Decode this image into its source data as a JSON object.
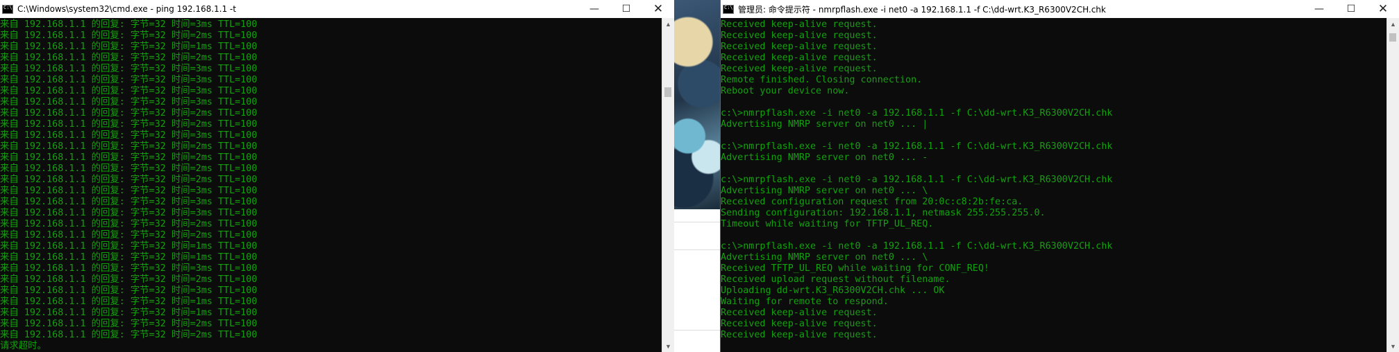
{
  "colors": {
    "console_bg": "#0c0c0c",
    "console_text": "#13a10e",
    "titlebar_bg": "#ffffff"
  },
  "left_window": {
    "title": "C:\\Windows\\system32\\cmd.exe - ping  192.168.1.1 -t",
    "icon": "cmd-icon",
    "controls": {
      "minimize": "—",
      "maximize": "☐",
      "close": "✕"
    },
    "lines": [
      "来自 192.168.1.1 的回复: 字节=32 时间=3ms TTL=100",
      "来自 192.168.1.1 的回复: 字节=32 时间=2ms TTL=100",
      "来自 192.168.1.1 的回复: 字节=32 时间=1ms TTL=100",
      "来自 192.168.1.1 的回复: 字节=32 时间=2ms TTL=100",
      "来自 192.168.1.1 的回复: 字节=32 时间=3ms TTL=100",
      "来自 192.168.1.1 的回复: 字节=32 时间=3ms TTL=100",
      "来自 192.168.1.1 的回复: 字节=32 时间=3ms TTL=100",
      "来自 192.168.1.1 的回复: 字节=32 时间=3ms TTL=100",
      "来自 192.168.1.1 的回复: 字节=32 时间=2ms TTL=100",
      "来自 192.168.1.1 的回复: 字节=32 时间=2ms TTL=100",
      "来自 192.168.1.1 的回复: 字节=32 时间=3ms TTL=100",
      "来自 192.168.1.1 的回复: 字节=32 时间=2ms TTL=100",
      "来自 192.168.1.1 的回复: 字节=32 时间=2ms TTL=100",
      "来自 192.168.1.1 的回复: 字节=32 时间=2ms TTL=100",
      "来自 192.168.1.1 的回复: 字节=32 时间=2ms TTL=100",
      "来自 192.168.1.1 的回复: 字节=32 时间=3ms TTL=100",
      "来自 192.168.1.1 的回复: 字节=32 时间=3ms TTL=100",
      "来自 192.168.1.1 的回复: 字节=32 时间=3ms TTL=100",
      "来自 192.168.1.1 的回复: 字节=32 时间=2ms TTL=100",
      "来自 192.168.1.1 的回复: 字节=32 时间=2ms TTL=100",
      "来自 192.168.1.1 的回复: 字节=32 时间=1ms TTL=100",
      "来自 192.168.1.1 的回复: 字节=32 时间=1ms TTL=100",
      "来自 192.168.1.1 的回复: 字节=32 时间=3ms TTL=100",
      "来自 192.168.1.1 的回复: 字节=32 时间=2ms TTL=100",
      "来自 192.168.1.1 的回复: 字节=32 时间=3ms TTL=100",
      "来自 192.168.1.1 的回复: 字节=32 时间=1ms TTL=100",
      "来自 192.168.1.1 的回复: 字节=32 时间=1ms TTL=100",
      "来自 192.168.1.1 的回复: 字节=32 时间=2ms TTL=100",
      "来自 192.168.1.1 的回复: 字节=32 时间=2ms TTL=100",
      "请求超时。"
    ]
  },
  "right_window": {
    "title": "管理员: 命令提示符 - nmrpflash.exe  -i net0 -a 192.168.1.1  -f C:\\dd-wrt.K3_R6300V2CH.chk",
    "icon": "cmd-icon",
    "controls": {
      "minimize": "—",
      "maximize": "☐",
      "close": "✕"
    },
    "lines": [
      "Received keep-alive request.",
      "Received keep-alive request.",
      "Received keep-alive request.",
      "Received keep-alive request.",
      "Received keep-alive request.",
      "Remote finished. Closing connection.",
      "Reboot your device now.",
      "",
      "c:\\>nmrpflash.exe -i net0 -a 192.168.1.1 -f C:\\dd-wrt.K3_R6300V2CH.chk",
      "Advertising NMRP server on net0 ... |",
      "",
      "c:\\>nmrpflash.exe -i net0 -a 192.168.1.1 -f C:\\dd-wrt.K3_R6300V2CH.chk",
      "Advertising NMRP server on net0 ... -",
      "",
      "c:\\>nmrpflash.exe -i net0 -a 192.168.1.1 -f C:\\dd-wrt.K3_R6300V2CH.chk",
      "Advertising NMRP server on net0 ... \\",
      "Received configuration request from 20:0c:c8:2b:fe:ca.",
      "Sending configuration: 192.168.1.1, netmask 255.255.255.0.",
      "Timeout while waiting for TFTP_UL_REQ.",
      "",
      "c:\\>nmrpflash.exe -i net0 -a 192.168.1.1 -f C:\\dd-wrt.K3_R6300V2CH.chk",
      "Advertising NMRP server on net0 ... \\",
      "Received TFTP_UL_REQ while waiting for CONF_REQ!",
      "Received upload request without filename.",
      "Uploading dd-wrt.K3_R6300V2CH.chk ... OK",
      "Waiting for remote to respond.",
      "Received keep-alive request.",
      "Received keep-alive request.",
      "Received keep-alive request."
    ]
  }
}
